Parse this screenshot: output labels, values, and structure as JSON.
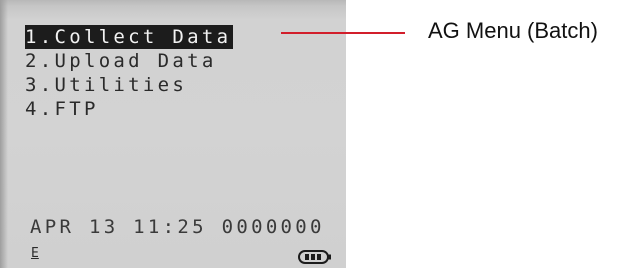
{
  "screen": {
    "menu_items": [
      {
        "label": "1.Collect Data",
        "selected": true
      },
      {
        "label": "2.Upload Data",
        "selected": false
      },
      {
        "label": "3.Utilities",
        "selected": false
      },
      {
        "label": "4.FTP",
        "selected": false
      }
    ],
    "status_line": "APR 13 11:25 0000000",
    "mode_indicator": "E",
    "battery_icon": "battery-icon"
  },
  "callout": {
    "label": "AG Menu (Batch)",
    "line_color": "#d21e2b"
  },
  "colors": {
    "screen_bg": "#d3d3d3",
    "text": "#2a2a2a",
    "selection_bg": "#1c1c1c",
    "selection_text": "#f2f2f2"
  }
}
